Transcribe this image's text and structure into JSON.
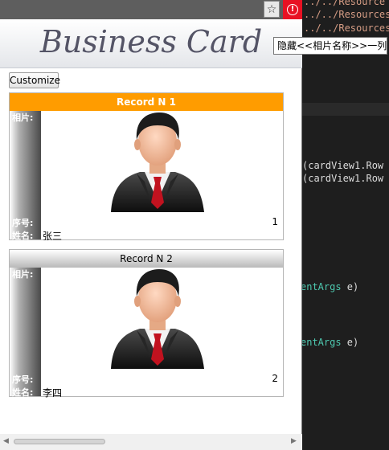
{
  "editor": {
    "lines": [
      {
        "before": "",
        "strA": "../../Resource",
        "after": ""
      },
      {
        "before": "",
        "strA": "../../Resources",
        "after": ""
      },
      {
        "before": "",
        "strA": "../../Resources",
        "after": ""
      }
    ],
    "line4": "(cardView1.Row",
    "line5": "(cardView1.Row",
    "args1_type": "entArgs",
    "args1_rest": " e)",
    "args2_type": "entArgs",
    "args2_rest": " e)"
  },
  "window": {
    "title_star_icon": "☆",
    "close_icon": "!"
  },
  "header": {
    "title": "Business Card"
  },
  "tooltip": {
    "text": "隐藏<<相片名称>>一列"
  },
  "toolbar": {
    "customize_label": "Customize"
  },
  "cards": [
    {
      "header": "Record N 1",
      "photo_label": "相片:",
      "seq_label": "序号:",
      "name_label": "姓名:",
      "seq": "1",
      "name": "张三"
    },
    {
      "header": "Record N 2",
      "photo_label": "相片:",
      "seq_label": "序号:",
      "name_label": "姓名:",
      "seq": "2",
      "name": "李四"
    }
  ],
  "scrollbar": {
    "left_arrow": "◀",
    "right_arrow": "▶"
  },
  "colors": {
    "card1_header": "#ff9c00",
    "close_button": "#e81123"
  }
}
